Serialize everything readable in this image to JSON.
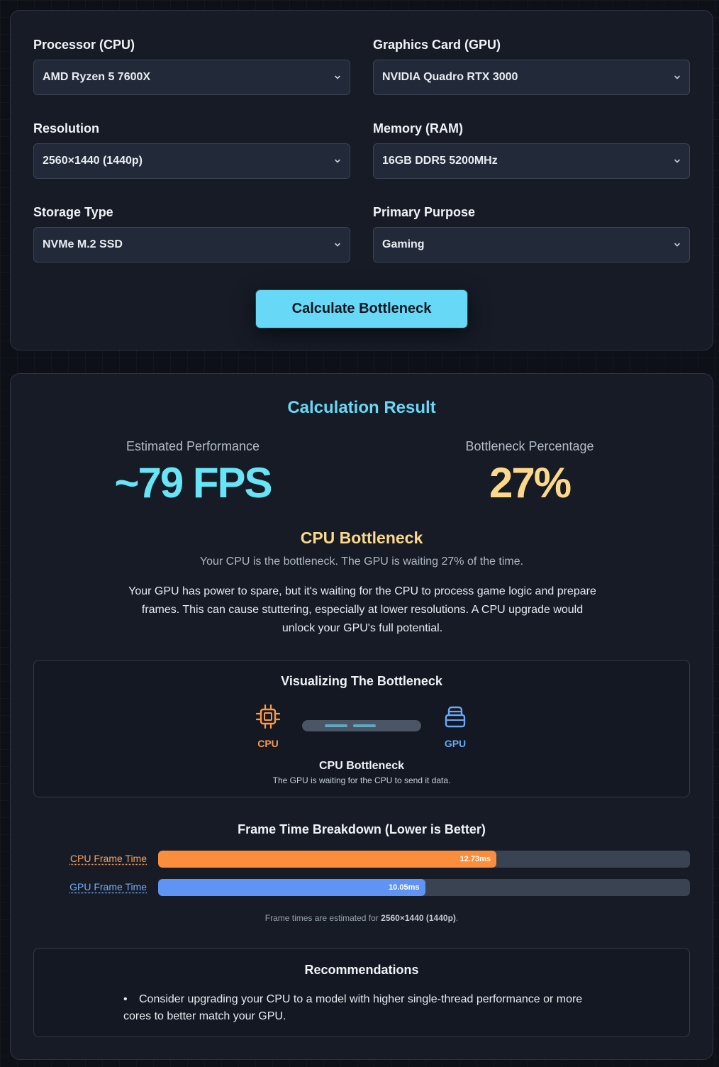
{
  "form": {
    "fields": [
      {
        "label": "Processor (CPU)",
        "value": "AMD Ryzen 5 7600X"
      },
      {
        "label": "Graphics Card (GPU)",
        "value": "NVIDIA Quadro RTX 3000"
      },
      {
        "label": "Resolution",
        "value": "2560×1440 (1440p)"
      },
      {
        "label": "Memory (RAM)",
        "value": "16GB DDR5 5200MHz"
      },
      {
        "label": "Storage Type",
        "value": "NVMe M.2 SSD"
      },
      {
        "label": "Primary Purpose",
        "value": "Gaming"
      }
    ],
    "calculate_label": "Calculate Bottleneck"
  },
  "result": {
    "title": "Calculation Result",
    "performance_label": "Estimated Performance",
    "performance_value": "~79 FPS",
    "bottleneck_label": "Bottleneck Percentage",
    "bottleneck_value": "27%",
    "bottleneck_type": "CPU Bottleneck",
    "summary": "Your CPU is the bottleneck. The GPU is waiting 27% of the time.",
    "description": "Your GPU has power to spare, but it's waiting for the CPU to process game logic and prepare frames. This can cause stuttering, especially at lower resolutions. A CPU upgrade would unlock your GPU's full potential."
  },
  "visualization": {
    "title": "Visualizing The Bottleneck",
    "cpu_label": "CPU",
    "gpu_label": "GPU",
    "status": "CPU Bottleneck",
    "substatus": "The GPU is waiting for the CPU to send it data.",
    "cpu_icon": "cpu-chip-icon",
    "gpu_icon": "gpu-card-icon",
    "colors": {
      "cpu": "#fb9a4b",
      "gpu": "#6aa8f7"
    }
  },
  "frame_time": {
    "title": "Frame Time Breakdown (Lower is Better)",
    "rows": [
      {
        "label": "CPU Frame Time",
        "value": "12.73ms",
        "fraction": 0.636
      },
      {
        "label": "GPU Frame Time",
        "value": "10.05ms",
        "fraction": 0.502
      }
    ],
    "note_prefix": "Frame times are estimated for ",
    "note_resolution": "2560×1440 (1440p)",
    "note_suffix": "."
  },
  "recommendations": {
    "title": "Recommendations",
    "items": [
      "Consider upgrading your CPU to a model with higher single-thread performance or more cores to better match your GPU."
    ]
  },
  "colors": {
    "accent": "#67d8f5",
    "warning": "#fcd98a",
    "cpu_bar": "#fb8e3c",
    "gpu_bar": "#5f93f4"
  }
}
